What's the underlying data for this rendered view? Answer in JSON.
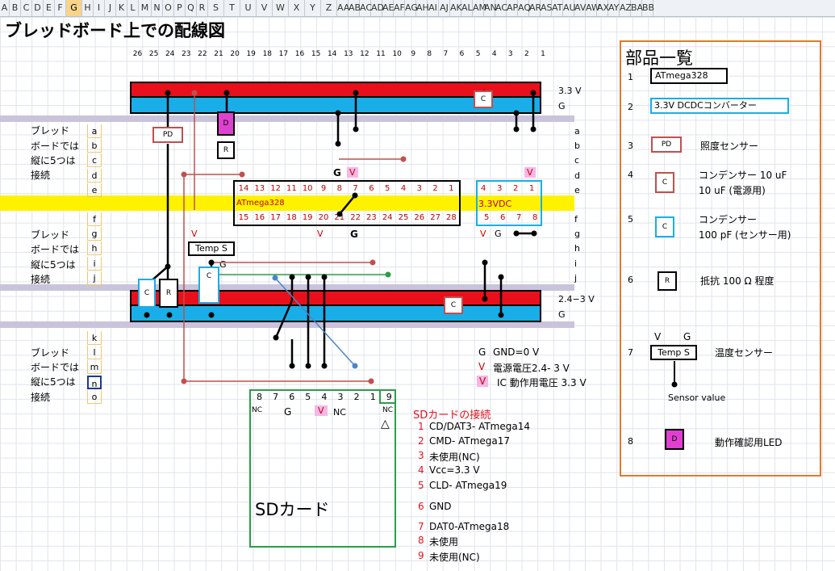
{
  "columns": [
    "A",
    "B",
    "C",
    "D",
    "E",
    "F",
    "G",
    "H",
    "I",
    "J",
    "K",
    "L",
    "M",
    "N",
    "O",
    "P",
    "Q",
    "R",
    "S",
    "T",
    "U",
    "V",
    "W",
    "X",
    "Y",
    "Z",
    "AA",
    "AB",
    "AC",
    "AD",
    "AE",
    "AF",
    "AG",
    "AH",
    "AI",
    "AJ",
    "AK",
    "AL",
    "AM",
    "AN",
    "AC",
    "AP",
    "AQ",
    "AR",
    "AS",
    "AT",
    "AU",
    "AV",
    "AW",
    "AX",
    "AY",
    "AZ",
    "BA",
    "BB"
  ],
  "selected_column": "G",
  "title": "ブレッドボード上での配線図",
  "pin_numbers": [
    "26",
    "25",
    "24",
    "23",
    "22",
    "21",
    "20",
    "19",
    "18",
    "17",
    "16",
    "15",
    "14",
    "13",
    "12",
    "11",
    "10",
    "9",
    "8",
    "7",
    "6",
    "5",
    "4",
    "3",
    "2",
    "1"
  ],
  "row_labels_top": [
    "ブレッド",
    "ボードでは",
    "縦に5つは",
    "接続"
  ],
  "row_letters_top": [
    "a",
    "b",
    "c",
    "d",
    "e"
  ],
  "row_letters_mid": [
    "f",
    "g",
    "h",
    "i",
    "j"
  ],
  "row_letters_bot": [
    "k",
    "l",
    "m",
    "n",
    "o"
  ],
  "rail_top": {
    "v": "3.3 V",
    "g": "G"
  },
  "rail_mid": {
    "v": "2.4−3 V",
    "g": "G"
  },
  "atmega": {
    "name": "ATmega328",
    "top_pins": [
      "14",
      "13",
      "12",
      "11",
      "10",
      "9",
      "8",
      "7",
      "6",
      "5",
      "4",
      "3",
      "2",
      "1"
    ],
    "bottom_pins": [
      "15",
      "16",
      "17",
      "18",
      "19",
      "20",
      "21",
      "22",
      "23",
      "24",
      "25",
      "26",
      "27",
      "28"
    ]
  },
  "dcdc": {
    "name": "3.3VDC",
    "top_pins": [
      "4",
      "3",
      "2",
      "1"
    ],
    "bottom_pins": [
      "5",
      "6",
      "7",
      "8"
    ]
  },
  "labels": {
    "g": "G",
    "v": "V",
    "pd": "PD",
    "d": "D",
    "r": "R",
    "c": "C",
    "temp": "Temp S"
  },
  "legend_text": {
    "gnd": "GND=0 V",
    "supply": "電源電圧2.4- 3 V",
    "ic": "IC 動作用電圧 3.3 V",
    "nc": "NC",
    "tri": "△"
  },
  "sd": {
    "pins": [
      "8",
      "7",
      "6",
      "5",
      "4",
      "3",
      "2",
      "1",
      "9"
    ],
    "name": "SDカード",
    "connection_title": "SDカードの接続",
    "list": [
      {
        "n": "1",
        "t": "CD/DAT3- ATmega14"
      },
      {
        "n": "2",
        "t": "CMD- ATmega17"
      },
      {
        "n": "3",
        "t": "未使用(NC)"
      },
      {
        "n": "4",
        "t": "Vcc=3.3 V"
      },
      {
        "n": "5",
        "t": "CLD- ATmega19"
      },
      {
        "n": "6",
        "t": "GND"
      },
      {
        "n": "7",
        "t": "DAT0-ATmega18"
      },
      {
        "n": "8",
        "t": "未使用"
      },
      {
        "n": "9",
        "t": "未使用(NC)"
      }
    ]
  },
  "parts": {
    "title": "部品一覧",
    "items": [
      {
        "n": "1",
        "box": "ATmega328",
        "desc": ""
      },
      {
        "n": "2",
        "box": "3.3V DCDCコンバーター",
        "desc": ""
      },
      {
        "n": "3",
        "box": "PD",
        "desc": "照度センサー"
      },
      {
        "n": "4",
        "box": "C",
        "desc": "コンデンサー 10 uF",
        "desc2": "10 uF (電源用)"
      },
      {
        "n": "5",
        "box": "C",
        "desc": "コンデンサー",
        "desc2": "100 pF (センサー用)"
      },
      {
        "n": "6",
        "box": "R",
        "desc": "抵抗 100 Ω 程度"
      },
      {
        "n": "7",
        "box": "Temp S",
        "desc": "温度センサー",
        "v": "V",
        "g": "G",
        "sub": "Sensor value"
      },
      {
        "n": "8",
        "box": "D",
        "desc": "動作確認用LED"
      }
    ]
  },
  "colors": {
    "red": "#e8101a",
    "blue": "#19aee8",
    "yellow": "#fff200",
    "lavender": "#c9c3dc",
    "magenta": "#e040d0",
    "green": "#2a9e48",
    "orange": "#e07a2e",
    "pdred": "#c0504d"
  }
}
